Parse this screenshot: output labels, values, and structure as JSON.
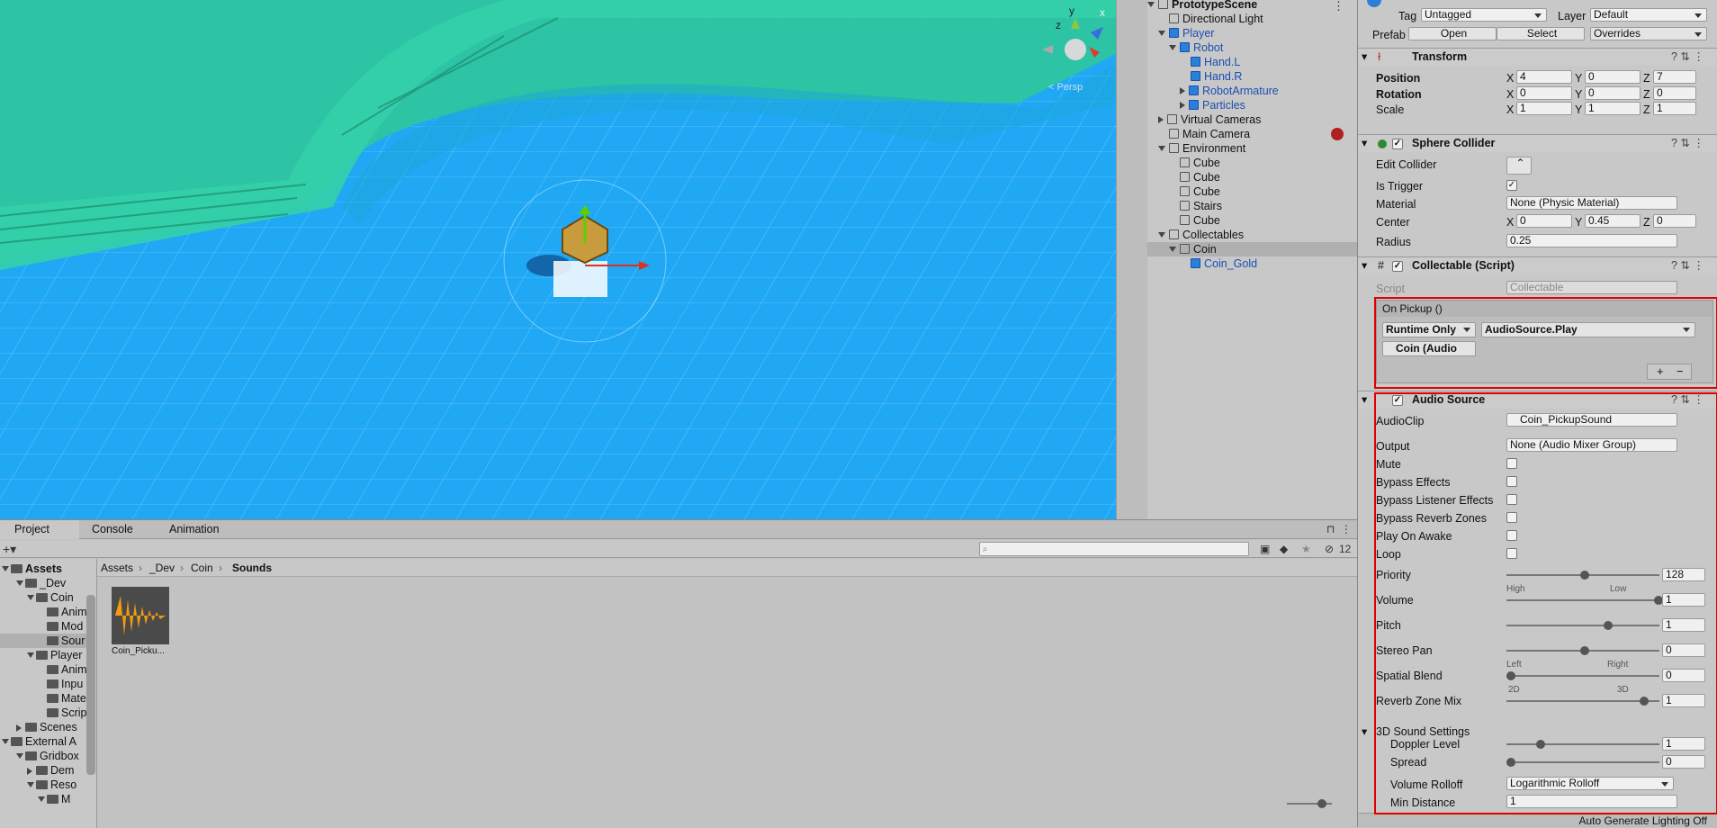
{
  "hierarchy": {
    "items": [
      {
        "label": "PrototypeScene",
        "indent": 0,
        "arrow": "down",
        "bold": true
      },
      {
        "label": "Directional Light",
        "indent": 1
      },
      {
        "label": "Player",
        "indent": 1,
        "arrow": "down",
        "blue": true
      },
      {
        "label": "Robot",
        "indent": 2,
        "arrow": "down",
        "blue": true
      },
      {
        "label": "Hand.L",
        "indent": 3,
        "blue": true
      },
      {
        "label": "Hand.R",
        "indent": 3,
        "blue": true
      },
      {
        "label": "RobotArmature",
        "indent": 3,
        "arrow": "right",
        "blue": true
      },
      {
        "label": "Particles",
        "indent": 3,
        "arrow": "right",
        "blue": true
      },
      {
        "label": "Virtual Cameras",
        "indent": 1,
        "arrow": "right"
      },
      {
        "label": "Main Camera",
        "indent": 1
      },
      {
        "label": "Environment",
        "indent": 1,
        "arrow": "down"
      },
      {
        "label": "Cube",
        "indent": 2
      },
      {
        "label": "Cube",
        "indent": 2
      },
      {
        "label": "Cube",
        "indent": 2
      },
      {
        "label": "Stairs",
        "indent": 2
      },
      {
        "label": "Cube",
        "indent": 2
      },
      {
        "label": "Collectables",
        "indent": 1,
        "arrow": "down"
      },
      {
        "label": "Coin",
        "indent": 2,
        "arrow": "down",
        "selected": true
      },
      {
        "label": "Coin_Gold",
        "indent": 3,
        "blue": true
      }
    ]
  },
  "scene": {
    "persp_label": "< Persp",
    "gizmo_y": "y",
    "gizmo_z": "z",
    "gizmo_x": "x"
  },
  "inspector": {
    "tag_label": "Tag",
    "tag_value": "Untagged",
    "layer_label": "Layer",
    "layer_value": "Default",
    "prefab_label": "Prefab",
    "open_btn": "Open",
    "select_btn": "Select",
    "overrides_btn": "Overrides",
    "transform": {
      "title": "Transform",
      "position_label": "Position",
      "rotation_label": "Rotation",
      "scale_label": "Scale",
      "position": [
        "4",
        "0",
        "7"
      ],
      "rotation": [
        "0",
        "0",
        "0"
      ],
      "scale": [
        "1",
        "1",
        "1"
      ]
    },
    "axes": [
      "X",
      "Y",
      "Z"
    ],
    "sphere_collider": {
      "title": "Sphere Collider",
      "edit_collider": "Edit Collider",
      "is_trigger": "Is Trigger",
      "material_label": "Material",
      "material_value": "None (Physic Material)",
      "center_label": "Center",
      "center": [
        "0",
        "0.45",
        "0"
      ],
      "radius_label": "Radius",
      "radius": "0.25"
    },
    "collectable": {
      "title": "Collectable (Script)",
      "script_label": "Script",
      "script_value": "Collectable",
      "on_pickup": "On Pickup ()",
      "runtime": "Runtime Only",
      "function": "AudioSource.Play",
      "target": "Coin (Audio",
      "plus": "+",
      "minus": "−"
    },
    "audio": {
      "title": "Audio Source",
      "clip_label": "AudioClip",
      "clip_value": "Coin_PickupSound",
      "output_label": "Output",
      "output_value": "None (Audio Mixer Group)",
      "mute": "Mute",
      "bypass_effects": "Bypass Effects",
      "bypass_listener": "Bypass Listener Effects",
      "bypass_reverb": "Bypass Reverb Zones",
      "play_on_awake": "Play On Awake",
      "loop": "Loop",
      "priority_label": "Priority",
      "priority": "128",
      "priority_high": "High",
      "priority_low": "Low",
      "volume_label": "Volume",
      "volume": "1",
      "pitch_label": "Pitch",
      "pitch": "1",
      "stereo_label": "Stereo Pan",
      "stereo": "0",
      "stereo_left": "Left",
      "stereo_right": "Right",
      "spatial_label": "Spatial Blend",
      "spatial": "0",
      "spatial_2d": "2D",
      "spatial_3d": "3D",
      "reverb_label": "Reverb Zone Mix",
      "reverb": "1",
      "sound3d_label": "3D Sound Settings",
      "doppler_label": "Doppler Level",
      "doppler": "1",
      "spread_label": "Spread",
      "spread": "0",
      "rolloff_label": "Volume Rolloff",
      "rolloff": "Logarithmic Rolloff",
      "mindist_label": "Min Distance",
      "mindist": "1",
      "slider_levels": {
        "priority": 0.5,
        "volume": 1.0,
        "pitch": 0.66,
        "stereo": 0.5,
        "spatial": 0.0,
        "reverb": 0.9,
        "doppler": 0.2,
        "spread": 0.0
      }
    },
    "status": "Auto Generate Lighting Off"
  },
  "bottom": {
    "tabs": [
      "Project",
      "Console",
      "Animation"
    ],
    "breadcrumb": [
      "Assets",
      "_Dev",
      "Coin",
      "Sounds"
    ],
    "count": "12",
    "asset_name": "Coin_Picku...",
    "tree": [
      {
        "label": "Assets",
        "x": 28,
        "bold": true,
        "arrow": "down"
      },
      {
        "label": "_Dev",
        "x": 44,
        "arrow": "down"
      },
      {
        "label": "Coin",
        "x": 56,
        "arrow": "down"
      },
      {
        "label": "Anim",
        "x": 68
      },
      {
        "label": "Mod",
        "x": 68
      },
      {
        "label": "Sour",
        "x": 68,
        "selected": true
      },
      {
        "label": "Player",
        "x": 56,
        "arrow": "down"
      },
      {
        "label": "Anim",
        "x": 68
      },
      {
        "label": "Inpu",
        "x": 68
      },
      {
        "label": "Mate",
        "x": 68
      },
      {
        "label": "Scrip",
        "x": 68
      },
      {
        "label": "Scenes",
        "x": 44,
        "arrow": "right"
      },
      {
        "label": "External A",
        "x": 28,
        "arrow": "down"
      },
      {
        "label": "Gridbox",
        "x": 44,
        "arrow": "down"
      },
      {
        "label": "Dem",
        "x": 56,
        "arrow": "right"
      },
      {
        "label": "Reso",
        "x": 56,
        "arrow": "down"
      },
      {
        "label": "M",
        "x": 68,
        "arrow": "down"
      }
    ]
  }
}
